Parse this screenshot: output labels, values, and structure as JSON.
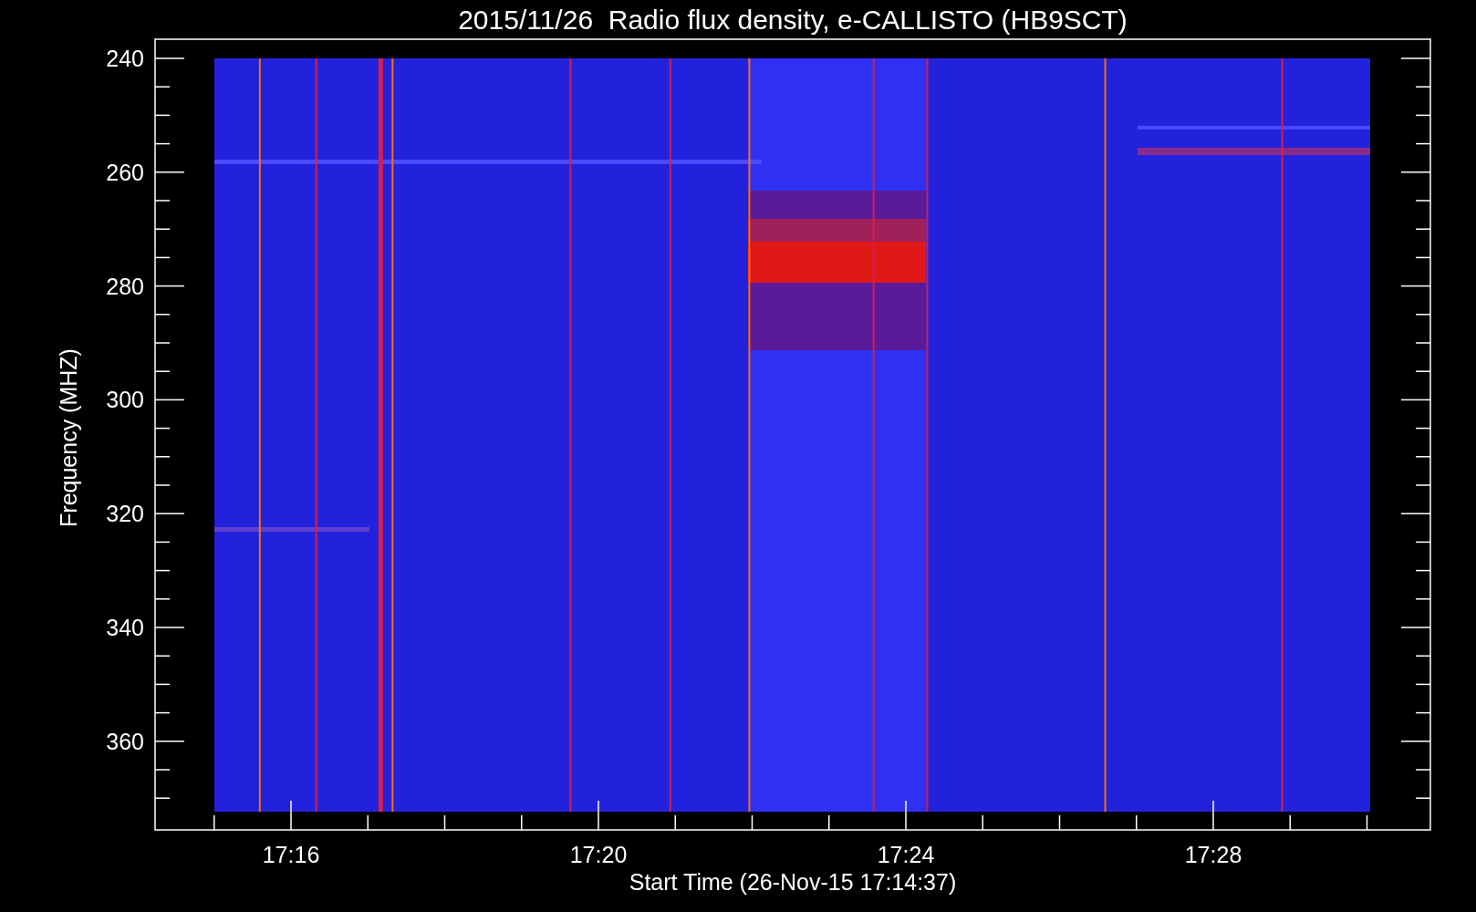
{
  "title": "2015/11/26  Radio flux density, e-CALLISTO (HB9SCT)",
  "y_axis": {
    "label": "Frequency (MHZ)",
    "ticks": [
      "240",
      "260",
      "280",
      "300",
      "320",
      "340",
      "360"
    ]
  },
  "x_axis": {
    "label": "Start Time (26-Nov-15 17:14:37)",
    "ticks": [
      "17:16",
      "17:20",
      "17:24",
      "17:28"
    ]
  }
}
